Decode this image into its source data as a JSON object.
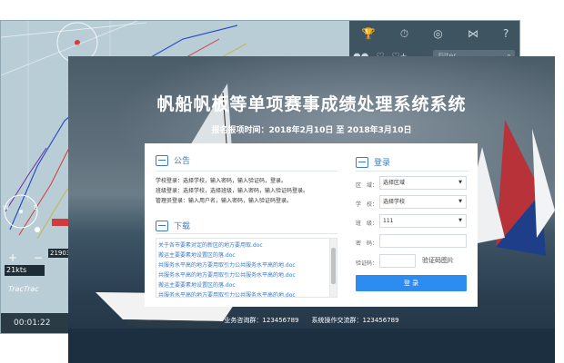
{
  "tracker": {
    "toolbar_icons": [
      "trophy-icon",
      "stopwatch-icon",
      "target-icon",
      "share-icon",
      "help-icon"
    ],
    "row2_icons": [
      "group-icon",
      "heart-icon",
      "heart-plus-icon"
    ],
    "filter_placeholder": "Filter",
    "timer": "00:01:22",
    "brand": "TracTrac",
    "speed_tag": "21kts",
    "boat_tag": "21903",
    "zoom_plus": "+",
    "zoom_minus": "−"
  },
  "front": {
    "title": "帆船帆板等单项赛事成绩处理系统系统",
    "subtitle": "报名报项时间：2018年2月10日 至 2018年3月10日",
    "notice": {
      "heading": "公告",
      "lines": [
        "学校登录：选择学校，输入密码，输入验证码，登录。",
        "班级登录：选择学校，选择班级，输入密码，输入验证码登录。",
        "管理员登录：输入用户名，输入密码，输入验证码登录。"
      ]
    },
    "download": {
      "heading": "下载",
      "files": [
        "关于各市要素对定的新区的地方要用取.doc",
        "搬运主要要素地设置区的落.doc",
        "共服务水平高的地方要用取引力公共服务水平高的地.doc",
        "共服务水平高的地方要用取引力公共服务水平高的地.doc",
        "搬运主要要素地设置区的落.doc",
        "共服务水平高的地方要用取引力公共服务水平高的地.doc"
      ]
    },
    "login": {
      "heading": "登录",
      "fields": [
        {
          "label": "区　域：",
          "value": "选择区域",
          "dropdown": true
        },
        {
          "label": "学　校：",
          "value": "选择学校",
          "dropdown": true
        },
        {
          "label": "班　级：",
          "value": "111",
          "dropdown": true
        },
        {
          "label": "密　码：",
          "value": "",
          "dropdown": false
        }
      ],
      "captcha_label": "验证码：",
      "captcha_image_text": "验证码图片",
      "button": "登 录"
    },
    "footer": "业务咨询群：123456789　　系统操作交流群：123456789"
  },
  "colors": {
    "accent": "#2d8cf0",
    "link": "#3c7cc1",
    "tracker_bg": "#b9cdd6",
    "toolbar_bg": "#3e5461"
  }
}
